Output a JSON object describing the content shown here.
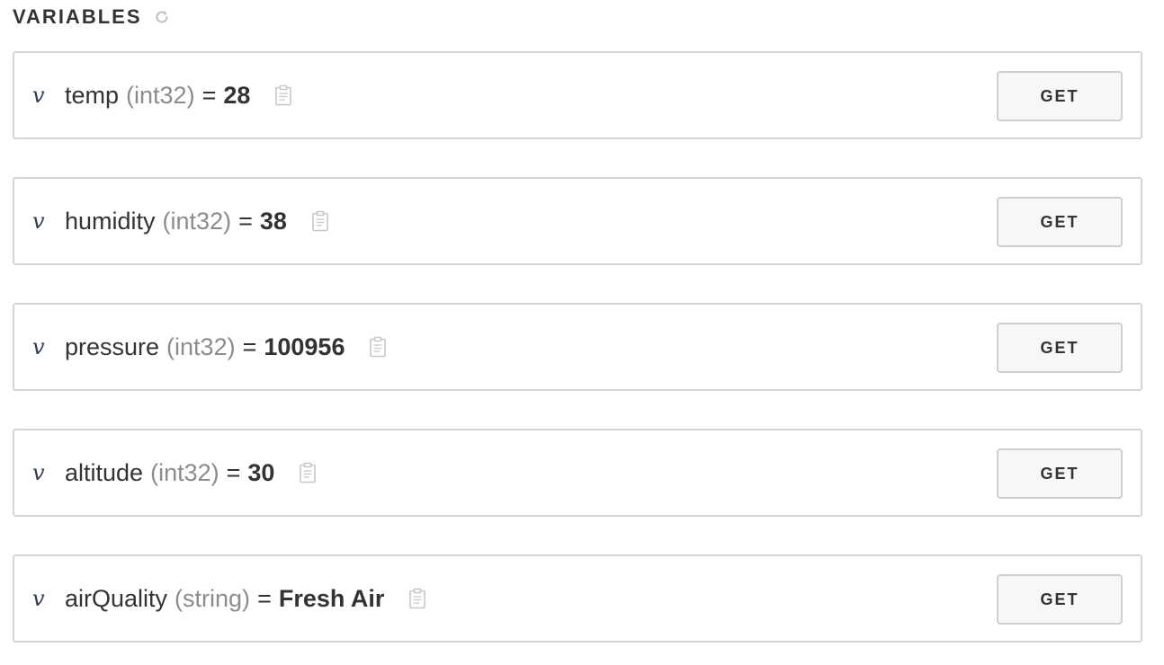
{
  "header": {
    "title": "VARIABLES",
    "refresh_icon": "refresh-icon"
  },
  "colors": {
    "border": "#d6d6d6",
    "text": "#333333",
    "type_text": "#8c8c8c",
    "v_icon": "#2c3e50",
    "button_bg": "#f7f7f7"
  },
  "variables": [
    {
      "icon": "v",
      "name": "temp",
      "type": "(int32)",
      "eq": "=",
      "value": "28",
      "button_label": "GET"
    },
    {
      "icon": "v",
      "name": "humidity",
      "type": "(int32)",
      "eq": "=",
      "value": "38",
      "button_label": "GET"
    },
    {
      "icon": "v",
      "name": "pressure",
      "type": "(int32)",
      "eq": "=",
      "value": "100956",
      "button_label": "GET"
    },
    {
      "icon": "v",
      "name": "altitude",
      "type": "(int32)",
      "eq": "=",
      "value": "30",
      "button_label": "GET"
    },
    {
      "icon": "v",
      "name": "airQuality",
      "type": "(string)",
      "eq": "=",
      "value": "Fresh Air",
      "button_label": "GET"
    }
  ]
}
